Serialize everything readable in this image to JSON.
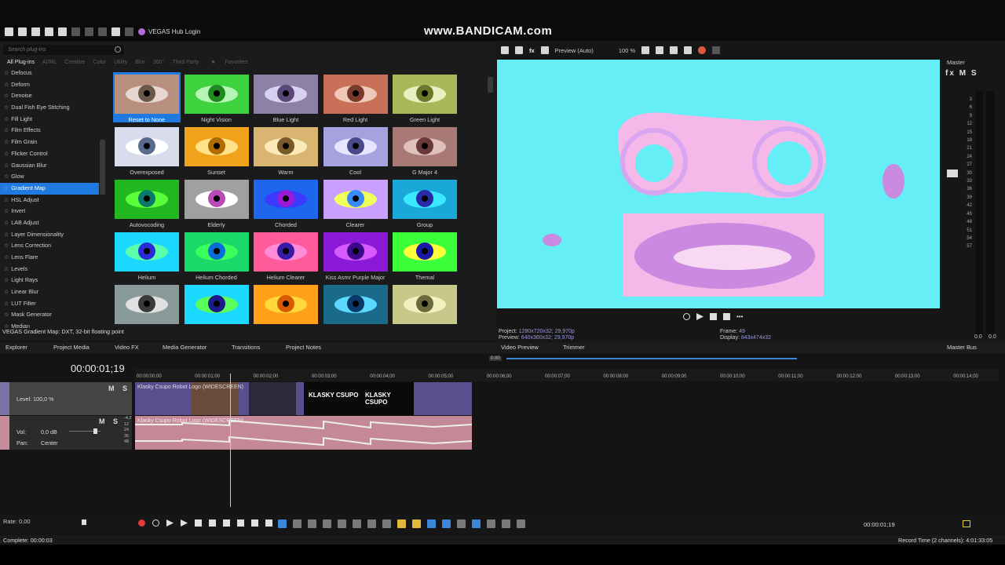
{
  "watermark": "www.BANDICAM.com",
  "toolbar": {
    "hub_login": "VEGAS Hub Login"
  },
  "plugins": {
    "search_placeholder": "Search plug-ins",
    "categories": [
      "All Plug-ins",
      "AI/ML",
      "Creative",
      "Color",
      "Utility",
      "Blur",
      "360°",
      "Third Party"
    ],
    "favorites_label": "Favorites",
    "tree": [
      "Defocus",
      "Deform",
      "Denoise",
      "Dual Fish Eye Stitching",
      "Fill Light",
      "Film Effects",
      "Film Grain",
      "Flicker Control",
      "Gaussian Blur",
      "Glow",
      "Gradient Map",
      "HSL Adjust",
      "Invert",
      "LAB Adjust",
      "Layer Dimensionality",
      "Lens Correction",
      "Lens Flare",
      "Levels",
      "Light Rays",
      "Linear Blur",
      "LUT Filter",
      "Mask Generator",
      "Median"
    ],
    "selected_tree_item": "Gradient Map",
    "presets": [
      {
        "label": "Reset to None",
        "sclera": "#e8d6d2",
        "iris": "#6b5a4a",
        "skin": "#b98f7d",
        "selected": true
      },
      {
        "label": "Night Vision",
        "sclera": "#b7f5b7",
        "iris": "#1f8a1f",
        "skin": "#3fd23f"
      },
      {
        "label": "Blue Light",
        "sclera": "#d7d2f0",
        "iris": "#5a4a7a",
        "skin": "#8c82a8"
      },
      {
        "label": "Red  Light",
        "sclera": "#f0c8b8",
        "iris": "#7a3a2a",
        "skin": "#c87058"
      },
      {
        "label": "Green  Light",
        "sclera": "#e6f0c0",
        "iris": "#6a7a2a",
        "skin": "#a8b85a"
      },
      {
        "label": "Overexposed",
        "sclera": "#ffffff",
        "iris": "#5a6a8a",
        "skin": "#d8dcec"
      },
      {
        "label": "Sunset",
        "sclera": "#ffe28a",
        "iris": "#b06a00",
        "skin": "#f0a21a"
      },
      {
        "label": "Warm",
        "sclera": "#fbe9b8",
        "iris": "#7a5a2a",
        "skin": "#d8b672"
      },
      {
        "label": "Cool",
        "sclera": "#e8e4ff",
        "iris": "#4a4a8a",
        "skin": "#a6a2e0"
      },
      {
        "label": "G Major 4",
        "sclera": "#e0c0bc",
        "iris": "#6a3a3a",
        "skin": "#a87a76"
      },
      {
        "label": "Autovocoding",
        "sclera": "#5aff3a",
        "iris": "#0a7a6a",
        "skin": "#22b822"
      },
      {
        "label": "Elderly",
        "sclera": "#ffffff",
        "iris": "#b84ab8",
        "skin": "#a0a0a0"
      },
      {
        "label": "Chorded",
        "sclera": "#3a3aff",
        "iris": "#9a1ad8",
        "skin": "#1e66ee"
      },
      {
        "label": "Clearer",
        "sclera": "#f0ff5a",
        "iris": "#3a8aff",
        "skin": "#c8a0ff"
      },
      {
        "label": "Group",
        "sclera": "#3ae8ff",
        "iris": "#2a2aa8",
        "skin": "#1aa8d8"
      },
      {
        "label": "Helium",
        "sclera": "#5affaa",
        "iris": "#2a2ad8",
        "skin": "#1ad8ff"
      },
      {
        "label": "Helium Chorded",
        "sclera": "#3aff5a",
        "iris": "#0a6ad8",
        "skin": "#1ad86a"
      },
      {
        "label": "Helium Clearer",
        "sclera": "#ff8ad8",
        "iris": "#3a1aa8",
        "skin": "#ff5a9a"
      },
      {
        "label": "Kiss Asmr Purple Major",
        "sclera": "#d85aff",
        "iris": "#3a0a8a",
        "skin": "#8a1ad8"
      },
      {
        "label": "Themal",
        "sclera": "#ffff3a",
        "iris": "#1a1aa8",
        "skin": "#3aff3a"
      },
      {
        "label": "",
        "sclera": "#e0e0e0",
        "iris": "#3a3a3a",
        "skin": "#8a9a9a"
      },
      {
        "label": "",
        "sclera": "#5aff5a",
        "iris": "#1a1a8a",
        "skin": "#1ad8ff"
      },
      {
        "label": "",
        "sclera": "#ffd83a",
        "iris": "#d85a00",
        "skin": "#ffa21a"
      },
      {
        "label": "",
        "sclera": "#5ad8ff",
        "iris": "#0a3a6a",
        "skin": "#1a6a8a"
      },
      {
        "label": "",
        "sclera": "#f0f0c0",
        "iris": "#6a6a3a",
        "skin": "#c8c88a"
      }
    ],
    "status": "VEGAS Gradient Map: DXT, 32-bit floating point"
  },
  "preview": {
    "mode": "Preview (Auto)",
    "zoom": "100 %",
    "project_label": "Project:",
    "project_value": "1280x720x32; 29,970p",
    "preview_label": "Preview:",
    "preview_value": "640x360x32; 29,970p",
    "frame_label": "Frame:",
    "frame_value": "49",
    "display_label": "Display:",
    "display_value": "843x474x32"
  },
  "master": {
    "title": "Master",
    "fx": "fx",
    "m": "M",
    "s": "S",
    "scale": [
      "3",
      "6",
      "9",
      "12",
      "15",
      "18",
      "21",
      "24",
      "27",
      "30",
      "33",
      "36",
      "39",
      "42",
      "45",
      "48",
      "51",
      "54",
      "57"
    ],
    "left_val": "0.0",
    "right_val": "0.0"
  },
  "tabs": {
    "explorer": "Explorer",
    "project_media": "Project Media",
    "video_fx": "Video FX",
    "media_generator": "Media Generator",
    "transitions": "Transitions",
    "project_notes": "Project Notes",
    "video_preview": "Video Preview",
    "trimmer": "Trimmer",
    "master_bus": "Master Bus"
  },
  "timeline": {
    "timecode": "00:00:01;19",
    "loop_region": "0:00",
    "ruler": [
      "00:00:00;00",
      "00:00:01;00",
      "00:00:02;00",
      "00:00:03;00",
      "00:00:04;00",
      "00:00:05;00",
      "00:00:06;00",
      "00:00:07;00",
      "00:00:08;00",
      "00:00:09;00",
      "00:00:10;00",
      "00:00:11;00",
      "00:00:12;00",
      "00:00:13;00",
      "00:00:14;00"
    ],
    "video_track": {
      "level": "Level: 100,0 %",
      "m": "M",
      "s": "S"
    },
    "audio_track": {
      "vol_label": "Vol:",
      "vol_value": "0,0 dB",
      "pan_label": "Pan:",
      "pan_value": "Center",
      "m": "M",
      "s": "S"
    },
    "db_scale": [
      "-4,2",
      "12",
      "24",
      "36",
      "48"
    ],
    "clip_label": "Klasky Csupo Robot Logo (WIDESCREEN)",
    "clip_text": "KLASKY CSUPO"
  },
  "bottom": {
    "rate": "Rate: 0,00",
    "timecode": "00:00:01;19",
    "complete": "Complete: 00:00:03",
    "record_time": "Record Time (2 channels): 4:01:33:05"
  },
  "colors": {
    "accent": "#1e7ae0",
    "preview_bg": "#66eef7",
    "face_pink": "#f5b8e8",
    "video_track": "#5a4e8e",
    "audio_track": "#c48896",
    "record": "#e03a3a"
  }
}
